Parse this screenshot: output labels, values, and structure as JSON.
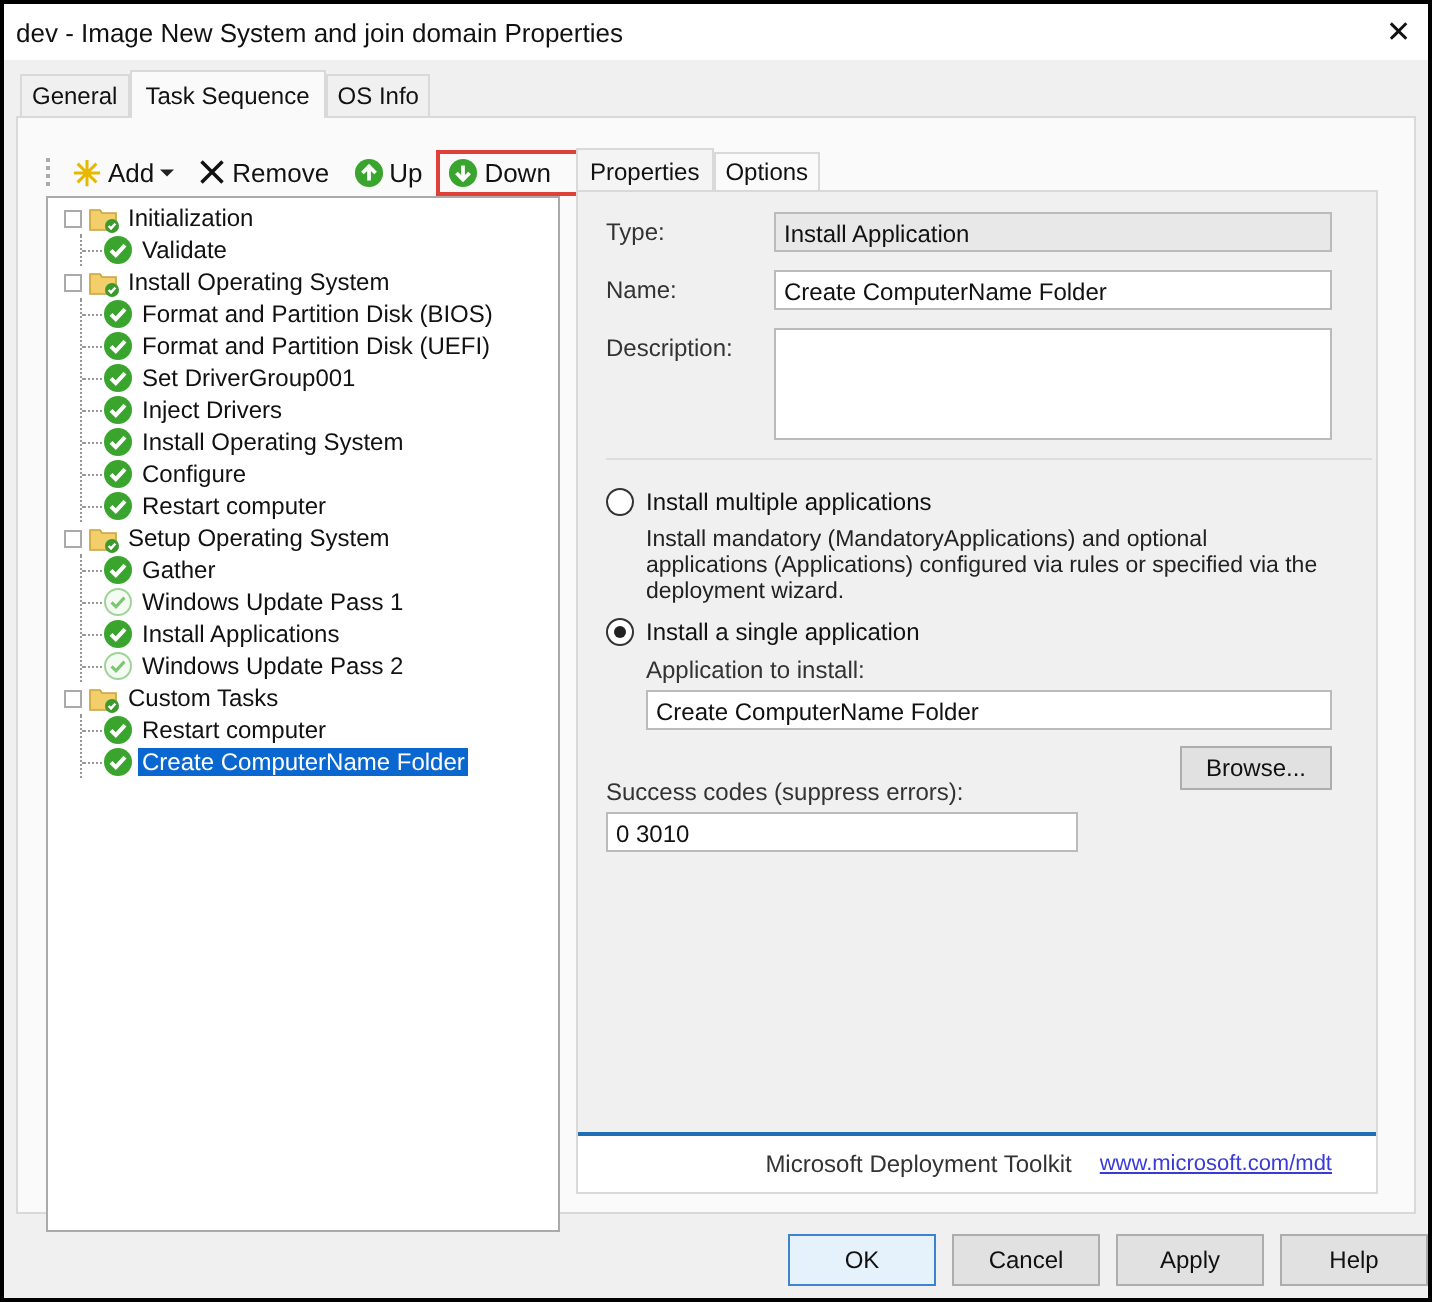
{
  "window": {
    "title": "dev - Image New System and join domain Properties",
    "close": "✕"
  },
  "tabs": [
    {
      "label": "General",
      "selected": false
    },
    {
      "label": "Task Sequence",
      "selected": true
    },
    {
      "label": "OS Info",
      "selected": false
    }
  ],
  "toolbar": [
    {
      "label": "Add",
      "kind": "add",
      "highlighted": false
    },
    {
      "label": "Remove",
      "kind": "remove",
      "highlighted": false
    },
    {
      "label": "Up",
      "kind": "up",
      "highlighted": false
    },
    {
      "label": "Down",
      "kind": "down",
      "highlighted": true
    }
  ],
  "tree": [
    {
      "label": "Initialization",
      "kind": "group",
      "selected": false,
      "children": [
        {
          "label": "Validate",
          "kind": "step",
          "disabled": false,
          "selected": false
        }
      ]
    },
    {
      "label": "Install Operating System",
      "kind": "group",
      "selected": false,
      "children": [
        {
          "label": "Format and Partition Disk (BIOS)",
          "kind": "step",
          "disabled": false,
          "selected": false
        },
        {
          "label": "Format and Partition Disk (UEFI)",
          "kind": "step",
          "disabled": false,
          "selected": false
        },
        {
          "label": "Set DriverGroup001",
          "kind": "step",
          "disabled": false,
          "selected": false
        },
        {
          "label": "Inject Drivers",
          "kind": "step",
          "disabled": false,
          "selected": false
        },
        {
          "label": "Install Operating System",
          "kind": "step",
          "disabled": false,
          "selected": false
        },
        {
          "label": "Configure",
          "kind": "step",
          "disabled": false,
          "selected": false
        },
        {
          "label": "Restart computer",
          "kind": "step",
          "disabled": false,
          "selected": false
        }
      ]
    },
    {
      "label": "Setup Operating System",
      "kind": "group",
      "selected": false,
      "children": [
        {
          "label": "Gather",
          "kind": "step",
          "disabled": false,
          "selected": false
        },
        {
          "label": "Windows Update Pass 1",
          "kind": "step",
          "disabled": true,
          "selected": false
        },
        {
          "label": "Install Applications",
          "kind": "step",
          "disabled": false,
          "selected": false
        },
        {
          "label": "Windows Update Pass 2",
          "kind": "step",
          "disabled": true,
          "selected": false
        }
      ]
    },
    {
      "label": "Custom Tasks",
      "kind": "group",
      "selected": false,
      "children": [
        {
          "label": "Restart computer",
          "kind": "step",
          "disabled": false,
          "selected": false
        },
        {
          "label": "Create ComputerName Folder",
          "kind": "step",
          "disabled": false,
          "selected": true
        }
      ]
    }
  ],
  "detail_tabs": [
    {
      "label": "Properties",
      "selected": true
    },
    {
      "label": "Options",
      "selected": false
    }
  ],
  "type": {
    "label": "Type:",
    "value": "Install Application"
  },
  "name": {
    "label": "Name:",
    "value": "Create ComputerName Folder"
  },
  "description": {
    "label": "Description:"
  },
  "options": [
    {
      "label": "Install multiple applications",
      "selected": false,
      "note": "Install mandatory (MandatoryApplications) and optional applications (Applications) configured via rules or specified via the deployment wizard."
    },
    {
      "label": "Install a single application",
      "selected": true
    }
  ],
  "application": {
    "label": "Application to install:",
    "value": "Create ComputerName Folder"
  },
  "browse": "Browse...",
  "success_codes": {
    "label": "Success codes (suppress errors):",
    "value": "0 3010"
  },
  "footer": {
    "product": "Microsoft Deployment Toolkit",
    "link": "www.microsoft.com/mdt"
  },
  "buttons": [
    {
      "label": "OK",
      "default": true
    },
    {
      "label": "Cancel",
      "default": false
    },
    {
      "label": "Apply",
      "default": false
    },
    {
      "label": "Help",
      "default": false
    }
  ]
}
